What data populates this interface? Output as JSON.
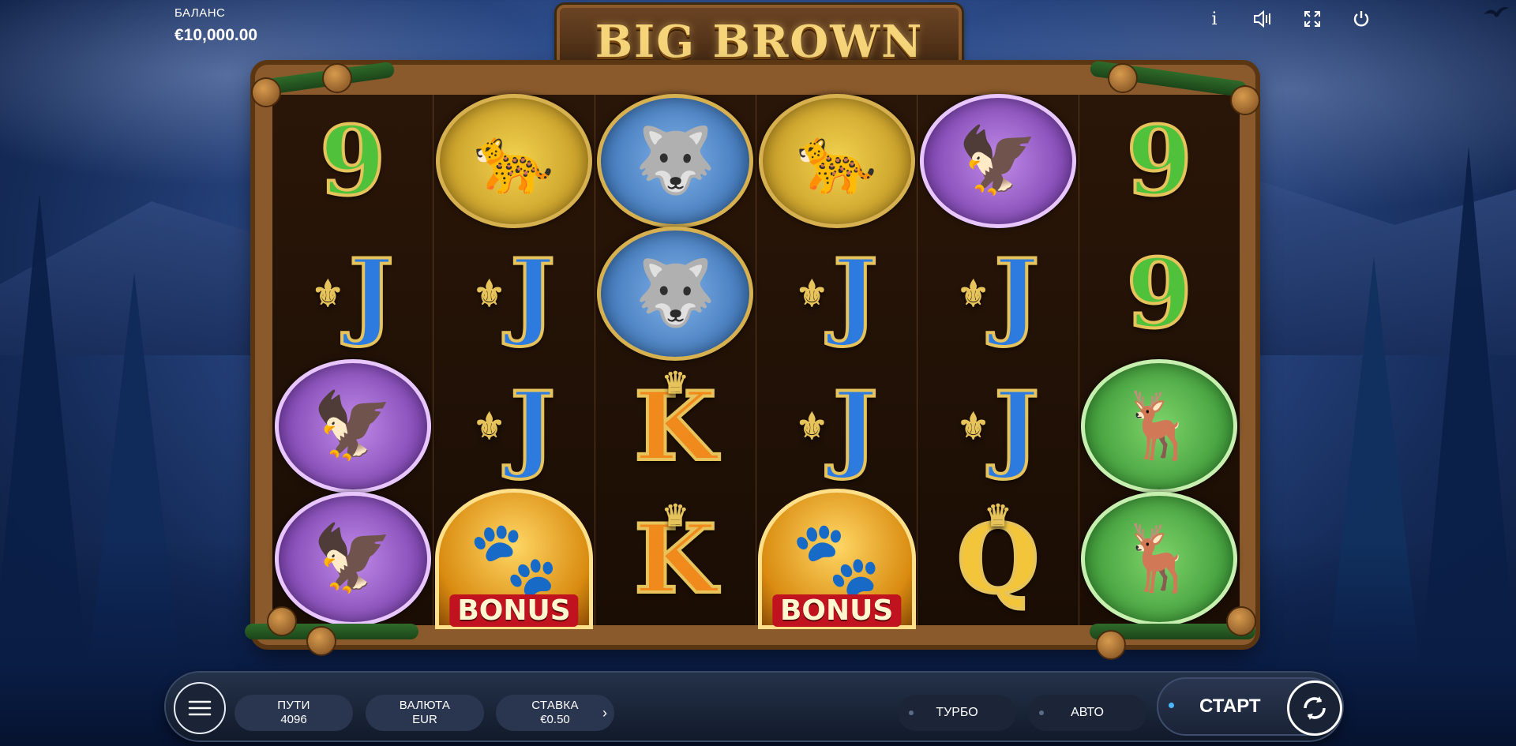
{
  "balance": {
    "label": "БАЛАНС",
    "value": "€10,000.00"
  },
  "logo": {
    "text": "BIG BROWN"
  },
  "top_icons": [
    "info-icon",
    "sound-icon",
    "fullscreen-icon",
    "power-icon"
  ],
  "top_icon_glyphs": {
    "info": "i",
    "sound": "◁)",
    "fullscreen": "⤢",
    "power": "⏻"
  },
  "reels": [
    [
      {
        "type": "nine",
        "text": "9"
      },
      {
        "type": "j",
        "text": "J"
      },
      {
        "type": "eagle"
      },
      {
        "type": "eagle"
      }
    ],
    [
      {
        "type": "cougar"
      },
      {
        "type": "j",
        "text": "J"
      },
      {
        "type": "j",
        "text": "J"
      },
      {
        "type": "bonus",
        "text": "BONUS"
      }
    ],
    [
      {
        "type": "wolf"
      },
      {
        "type": "wolf"
      },
      {
        "type": "k",
        "text": "K"
      },
      {
        "type": "k",
        "text": "K"
      }
    ],
    [
      {
        "type": "cougar"
      },
      {
        "type": "j",
        "text": "J"
      },
      {
        "type": "j",
        "text": "J"
      },
      {
        "type": "bonus",
        "text": "BONUS"
      }
    ],
    [
      {
        "type": "eagle"
      },
      {
        "type": "j",
        "text": "J"
      },
      {
        "type": "j",
        "text": "J"
      },
      {
        "type": "q",
        "text": "Q"
      }
    ],
    [
      {
        "type": "nine",
        "text": "9"
      },
      {
        "type": "nine",
        "text": "9"
      },
      {
        "type": "deer"
      },
      {
        "type": "deer"
      }
    ]
  ],
  "bottom": {
    "ways": {
      "label": "ПУТИ",
      "value": "4096"
    },
    "currency": {
      "label": "ВАЛЮТА",
      "value": "EUR"
    },
    "bet": {
      "label": "СТАВКА",
      "value": "€0.50"
    },
    "turbo": "ТУРБО",
    "auto": "АВТО",
    "start": "СТАРТ"
  },
  "colors": {
    "accent": "#4ab8ff",
    "frame": "#8a5a2c",
    "bar": "#111a2a"
  }
}
